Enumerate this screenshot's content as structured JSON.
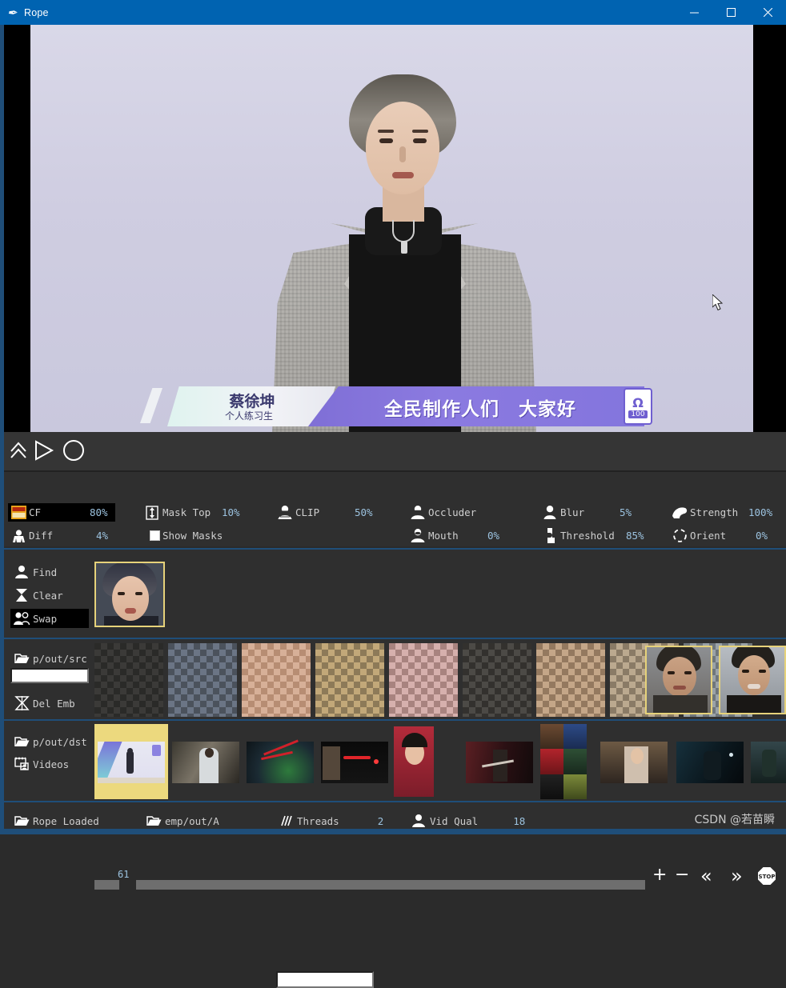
{
  "window": {
    "title": "Rope",
    "app_icon": "feather-icon",
    "minimize_label": "─",
    "maximize_label": "□",
    "close_label": "✕"
  },
  "video": {
    "banner": {
      "name": "蔡徐坤",
      "subtitle": "个人练习生",
      "headline": "全民制作人们　大家好",
      "logo_glyph": "Ω",
      "logo_number": "100"
    }
  },
  "transport": {
    "frame_number": "61",
    "buttons": [
      {
        "name": "load-markers",
        "glyph": "∧"
      },
      {
        "name": "play",
        "glyph": "▷"
      },
      {
        "name": "record",
        "glyph": "◯"
      },
      {
        "name": "add-marker",
        "glyph": "+"
      },
      {
        "name": "remove-marker",
        "glyph": "−"
      },
      {
        "name": "prev-marker",
        "glyph": "«"
      },
      {
        "name": "next-marker",
        "glyph": "»"
      },
      {
        "name": "stop",
        "glyph": "STOP"
      }
    ]
  },
  "params": {
    "col1": [
      {
        "icon": "gfpgan-icon",
        "label": "CF",
        "value": "80%",
        "selected": true
      },
      {
        "icon": "diff-icon",
        "label": "Diff",
        "value": "4%",
        "selected": false
      }
    ],
    "col2": [
      {
        "icon": "mask-top-icon",
        "label": "Mask Top",
        "value": "10%"
      },
      {
        "icon": "checkbox-icon",
        "label": "Show Masks",
        "value": ""
      }
    ],
    "col3": [
      {
        "icon": "clip-person-icon",
        "label": "CLIP",
        "value": "50%"
      }
    ],
    "clip_text_value": "",
    "clip_text_placeholder": "",
    "col4": [
      {
        "icon": "occluder-person-icon",
        "label": "Occluder",
        "value": ""
      },
      {
        "icon": "mouth-person-icon",
        "label": "Mouth",
        "value": "0%"
      }
    ],
    "col5": [
      {
        "icon": "blur-person-icon",
        "label": "Blur",
        "value": "5%"
      },
      {
        "icon": "threshold-icon",
        "label": "Threshold",
        "value": "85%"
      }
    ],
    "col6": [
      {
        "icon": "strength-icon",
        "label": "Strength",
        "value": "100%"
      },
      {
        "icon": "orient-icon",
        "label": "Orient",
        "value": "0%"
      }
    ]
  },
  "face_panel": {
    "buttons": [
      {
        "icon": "person-icon",
        "label": "Find",
        "active": false
      },
      {
        "icon": "clear-x-icon",
        "label": "Clear",
        "active": false
      },
      {
        "icon": "two-people-icon",
        "label": "Swap",
        "active": true
      }
    ],
    "selected_face_alt": "source-face-preview"
  },
  "source_panel": {
    "folder_icon": "open-folder-icon",
    "path_label": "p/out/src",
    "search_value": "",
    "del_emb_icon": "delete-embeddings-icon",
    "del_emb_label": "Del Emb",
    "thumbnail_count": 12,
    "selected_indices": [
      10,
      11
    ]
  },
  "target_panel": {
    "folder_icon": "open-folder-icon",
    "path_label": "p/out/dst",
    "videos_icon": "videos-icon",
    "videos_label": "Videos",
    "thumbnail_count": 10,
    "selected_index": 0
  },
  "status": {
    "items": [
      {
        "icon": "open-folder-icon",
        "label": "Rope Loaded",
        "value": ""
      },
      {
        "icon": "open-folder-icon",
        "label": "emp/out/A",
        "value": ""
      },
      {
        "icon": "threads-icon",
        "label": "Threads",
        "value": "2"
      },
      {
        "icon": "person-icon",
        "label": "Vid Qual",
        "value": "18"
      }
    ]
  },
  "watermark": "CSDN @若苗瞬",
  "colors": {
    "titlebar": "#0063b1",
    "accent_rail": "#1f4e79",
    "panel": "#2f2f2f",
    "value_text": "#9cc3e0",
    "label_text": "#cfcfcf",
    "selection_border": "#e6d27a"
  }
}
